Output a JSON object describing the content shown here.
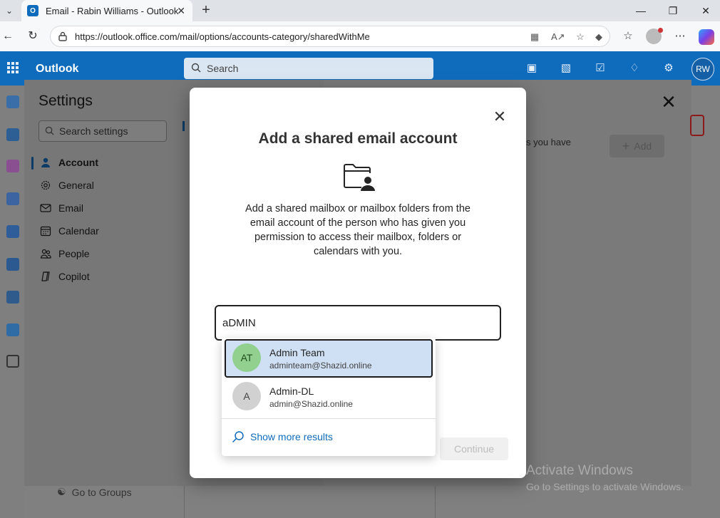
{
  "browser": {
    "tab_title": "Email - Rabin Williams - Outlook",
    "tab_favicon_letter": "O",
    "url": "https://outlook.office.com/mail/options/accounts-category/sharedWithMe"
  },
  "header": {
    "app_name": "Outlook",
    "search_placeholder": "Search",
    "avatar_initials": "RW",
    "accent_color": "#0f6cbd"
  },
  "settings": {
    "title": "Settings",
    "search_placeholder": "Search settings",
    "nav": [
      {
        "label": "Account",
        "icon": "person-icon",
        "active": true
      },
      {
        "label": "General",
        "icon": "gear-icon"
      },
      {
        "label": "Email",
        "icon": "mail-icon"
      },
      {
        "label": "Calendar",
        "icon": "calendar-icon"
      },
      {
        "label": "People",
        "icon": "people-icon"
      },
      {
        "label": "Copilot",
        "icon": "copilot-icon"
      }
    ],
    "partial_text": "s you have",
    "add_label": "Add",
    "go_to_groups": "Go to Groups"
  },
  "dialog": {
    "title": "Add a shared email account",
    "description": "Add a shared mailbox or mailbox folders from the email account of the person who has given you permission to access their mailbox, folders or calendars with you.",
    "input_value": "aDMIN",
    "continue_label": "Continue",
    "suggestions": [
      {
        "initials": "AT",
        "name": "Admin Team",
        "email": "adminteam@Shazid.online",
        "avatar_color": "#92d08f",
        "selected": true
      },
      {
        "initials": "A",
        "name": "Admin-DL",
        "email": "admin@Shazid.online",
        "avatar_color": "#d1d1d1",
        "selected": false
      }
    ],
    "show_more_label": "Show more results"
  },
  "watermark": {
    "line1": "Activate Windows",
    "line2": "Go to Settings to activate Windows."
  }
}
